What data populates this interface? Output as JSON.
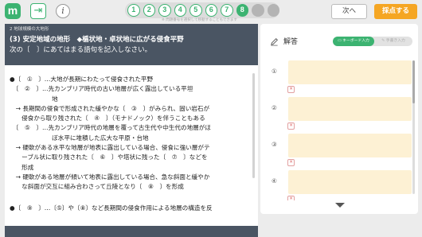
{
  "app": {
    "logo_letter": "m",
    "exit_glyph": "⇥",
    "info_glyph": "i"
  },
  "steps": {
    "items": [
      {
        "label": "1",
        "state": "done"
      },
      {
        "label": "2",
        "state": "done"
      },
      {
        "label": "3",
        "state": "done"
      },
      {
        "label": "4",
        "state": "done"
      },
      {
        "label": "5",
        "state": "done"
      },
      {
        "label": "6",
        "state": "done"
      },
      {
        "label": "7",
        "state": "done"
      },
      {
        "label": "8",
        "state": "current"
      },
      {
        "label": "",
        "state": "empty"
      },
      {
        "label": "",
        "state": "empty"
      }
    ],
    "note": "※ 問題番号を選択して移動することもできます"
  },
  "toolbar": {
    "next_label": "次へ",
    "score_label": "採点する"
  },
  "question": {
    "section": "2 地球規模の大地形",
    "title": "(3) 安定地域の地形　◆楯状地・卓状地に広がる侵食平野",
    "instruction": "次の〔　〕にあてはまる語句を記入しなさい。",
    "lines": [
      "●〔　①　〕…大地が長期にわたって侵食された平野",
      "　〔　②　〕…先カンブリア時代の古い地層が広く露出している平坦",
      "　　　　　　　地",
      "　→ 長期間の侵食で形成された緩やかな〔　③　〕がみられ、固い岩石が",
      "　　侵食から取り残された〔　④　〕（モナドノック）を伴うこともある",
      "　〔　⑤　〕…先カンブリア時代の地層を覆って古生代や中生代の地層がほ",
      "　　　　　　　ぼ水平に堆積した広大な平原・台地",
      "　→ 硬軟がある水平な地層が地表に露出している場合、侵食に強い層がテ",
      "　　ーブル状に取り残された〔　⑥　〕や塔状に残った〔　⑦　〕などを",
      "　　形成",
      "　→ 硬軟がある地層が傾いて地表に露出している場合、急な斜面と緩やか",
      "　　な斜面が交互に組み合わさって丘陵となり〔　⑧　〕を形成"
    ],
    "footer_line": "●〔　⑨　〕…〔⑤〕や〔⑧〕など長期間の侵食作用による地層の構造を反"
  },
  "answer": {
    "title": "解答",
    "toggle_keyboard": "キーボード入力",
    "toggle_handwriting": "手書き入力",
    "rows": [
      {
        "num": "①",
        "value": ""
      },
      {
        "num": "②",
        "value": ""
      },
      {
        "num": "③",
        "value": ""
      },
      {
        "num": "④",
        "value": ""
      }
    ],
    "clear_glyph": "✕"
  },
  "colors": {
    "accent_green": "#3cb371",
    "score_orange": "#f5a623",
    "header_slate": "#4a5563",
    "answer_box": "#fdf1d4"
  }
}
